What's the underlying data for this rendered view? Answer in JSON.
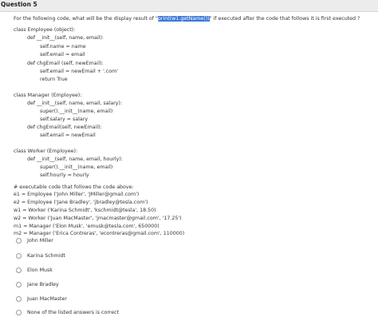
{
  "question": {
    "title": "Question 5",
    "prompt_before": "For the following code, what will be the display result of \"",
    "prompt_highlight": "print(w1.getName())",
    "prompt_after": "\" if executed after the code that follows it is first executed ?"
  },
  "code_lines": [
    "class Employee (object):",
    "def __init__(self, name, email):",
    "self.name = name",
    "self.email = email",
    "def chgEmail (self, newEmail):",
    "self.email = newEmail + '.com'",
    "return True",
    "class Manager (Employee):",
    "def __init__(self, name, email, salary):",
    "super().__init__(name, email)",
    "self.salary = salary",
    "def chgEmail(self, newEmail):",
    "self.email = newEmail",
    "class Worker (Employee):",
    "def __init__(self, name, email, hourly):",
    "super().__init__(name, email)",
    "self.hourly = hourly",
    "# executable code that follows the code above:",
    "e1 = Employee ('John Miller', 'JMiller@gmail.com')",
    "e2 = Employee ('Jane Bradley', 'jbradley@tesla.com')",
    "w1 = Worker   ('Karina Schmidt', 'kschmidt@tesla', 18.50)",
    "w2 = Worker   ('Juan MacMaster', 'jmacmaster@gmail.com', '17.25')",
    "m1 = Manager  ('Elon Musk', 'emusk@tesla.com', 650000)",
    "m2 = Manager  ('Erica Contreras', 'econtreras@gmail.com', 110000)"
  ],
  "options": [
    "John Miller",
    "Karina Schmidt",
    "Elon Musk",
    "Jane Bradley",
    "Juan MacMaster",
    "None of the listed answers is correct"
  ],
  "colors": {
    "highlight": "#3b78d8",
    "header_bg": "#ececec"
  }
}
